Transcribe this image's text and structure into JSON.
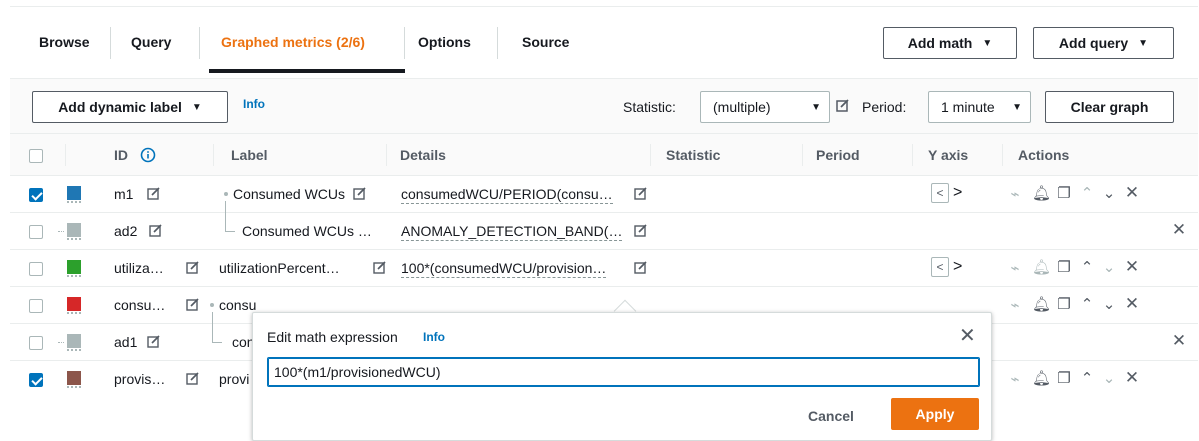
{
  "tabs": [
    {
      "label": "Browse",
      "active": false
    },
    {
      "label": "Query",
      "active": false
    },
    {
      "label": "Graphed metrics (2/6)",
      "active": true
    },
    {
      "label": "Options",
      "active": false
    },
    {
      "label": "Source",
      "active": false
    }
  ],
  "header_buttons": {
    "add_math": "Add math",
    "add_query": "Add query"
  },
  "toolbar": {
    "add_dynamic_label": "Add dynamic label",
    "info": "Info",
    "statistic_label": "Statistic:",
    "statistic_value": "(multiple)",
    "period_label": "Period:",
    "period_value": "1 minute",
    "clear_graph": "Clear graph"
  },
  "columns": [
    "ID",
    "Label",
    "Details",
    "Statistic",
    "Period",
    "Y axis",
    "Actions"
  ],
  "rows": [
    {
      "id": "m1",
      "label": "Consumed WCUs",
      "details": "consumedWCU/PERIOD(consu…",
      "checked": true,
      "color": "#1f77b4"
    },
    {
      "id": "ad2",
      "label": "Consumed WCUs …",
      "details": "ANOMALY_DETECTION_BAND(…",
      "checked": false,
      "color": "#aab7b8"
    },
    {
      "id": "utiliza…",
      "label": "utilizationPercent…",
      "details": "100*(consumedWCU/provision…",
      "checked": false,
      "color": "#2ca02c"
    },
    {
      "id": "consu…",
      "label": "consu",
      "details": "",
      "checked": false,
      "color": "#d62728"
    },
    {
      "id": "ad1",
      "label": "con",
      "details": "",
      "checked": false,
      "color": "#aab7b8"
    },
    {
      "id": "provis…",
      "label": "provi",
      "details": "",
      "checked": true,
      "color": "#8c564b"
    }
  ],
  "popover": {
    "title": "Edit math expression",
    "info": "Info",
    "expression": "100*(m1/provisionedWCU)",
    "cancel": "Cancel",
    "apply": "Apply"
  },
  "colors": {
    "accent": "#ec7211",
    "link": "#0073bb"
  }
}
